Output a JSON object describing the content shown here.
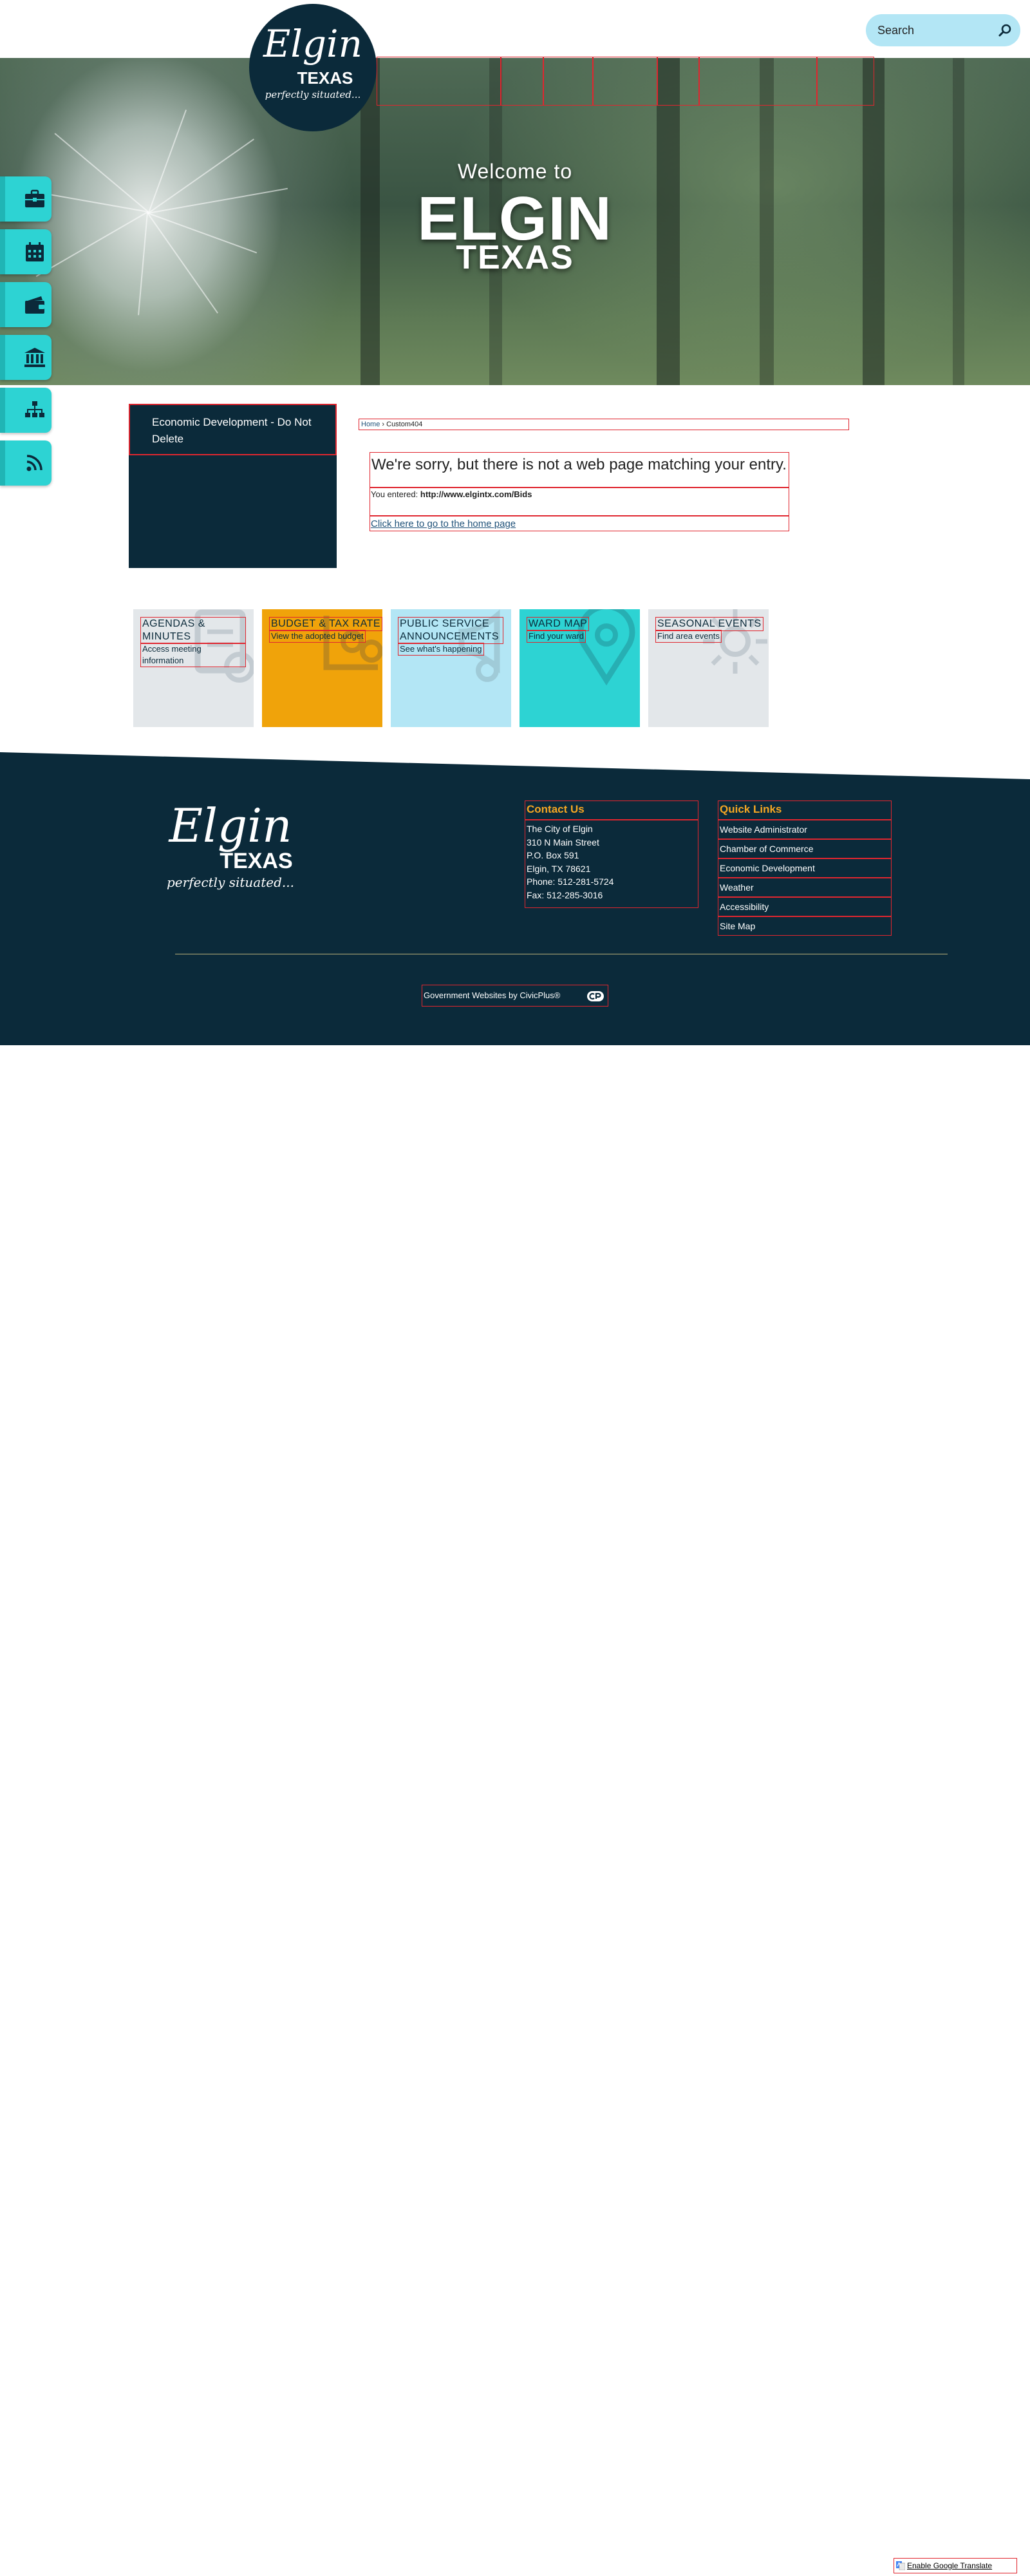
{
  "search": {
    "placeholder": "Search"
  },
  "logo": {
    "script": "Elgin",
    "state": "TEXAS",
    "tagline": "perfectly situated..."
  },
  "hero": {
    "welcome": "Welcome to",
    "city": "ELGIN",
    "state": "TEXAS"
  },
  "nav": {
    "items": [
      {
        "label": "",
        "name": "nav-item-1"
      },
      {
        "label": "",
        "name": "nav-item-2"
      },
      {
        "label": "",
        "name": "nav-item-3"
      },
      {
        "label": "",
        "name": "nav-item-4"
      },
      {
        "label": "",
        "name": "nav-item-5"
      },
      {
        "label": "",
        "name": "nav-item-6"
      },
      {
        "label": "",
        "name": "nav-item-7"
      }
    ]
  },
  "quick_bar": {
    "icons": [
      "briefcase-icon",
      "calendar-icon",
      "wallet-icon",
      "government-building-icon",
      "sitemap-icon",
      "rss-icon"
    ]
  },
  "sidenav": {
    "item_label": "Economic Development - Do Not Delete"
  },
  "breadcrumb": {
    "home": "Home",
    "separator": " › ",
    "current": "Custom404"
  },
  "error": {
    "title": "We're sorry, but there is not a web page matching your entry.",
    "entered_label": "You entered: ",
    "entered_url": "http://www.elgintx.com/Bids",
    "home_link": "Click here to go to the home page"
  },
  "tiles": [
    {
      "title": "AGENDAS & MINUTES",
      "subtitle": "Access meeting information",
      "bg": "#e3e7ea",
      "icon": "agenda-icon"
    },
    {
      "title": "BUDGET & TAX RATE",
      "subtitle": "View the adopted budget",
      "bg": "#f0a30a",
      "icon": "budget-icon"
    },
    {
      "title": "PUBLIC SERVICE ANNOUNCEMENTS",
      "subtitle": "See what's happening",
      "bg": "#b3e6f5",
      "icon": "announcement-icon"
    },
    {
      "title": "WARD MAP",
      "subtitle": "Find your ward",
      "bg": "#2dd3d3",
      "icon": "map-pin-icon"
    },
    {
      "title": "SEASONAL EVENTS",
      "subtitle": "Find area events",
      "bg": "#e3e7ea",
      "icon": "sun-icon"
    }
  ],
  "footer": {
    "contact_heading": "Contact Us",
    "contact_lines": [
      "The City of Elgin",
      "310 N Main Street",
      "P.O. Box 591",
      "Elgin, TX 78621",
      "Phone: 512-281-5724",
      "Fax: 512-285-3016"
    ],
    "quick_links_heading": "Quick Links",
    "quick_links": [
      "Website Administrator",
      "Chamber of Commerce",
      "Economic Development",
      "Weather",
      "Accessibility",
      "Site Map"
    ],
    "civicplus": "Government Websites by CivicPlus®"
  },
  "translate": {
    "label": "Enable Google Translate"
  },
  "colors": {
    "navy": "#0b2a3a",
    "teal": "#2dd3d3",
    "orange": "#f0a30a",
    "light_blue": "#b3e6f5",
    "footer_heading": "#f5a623"
  }
}
